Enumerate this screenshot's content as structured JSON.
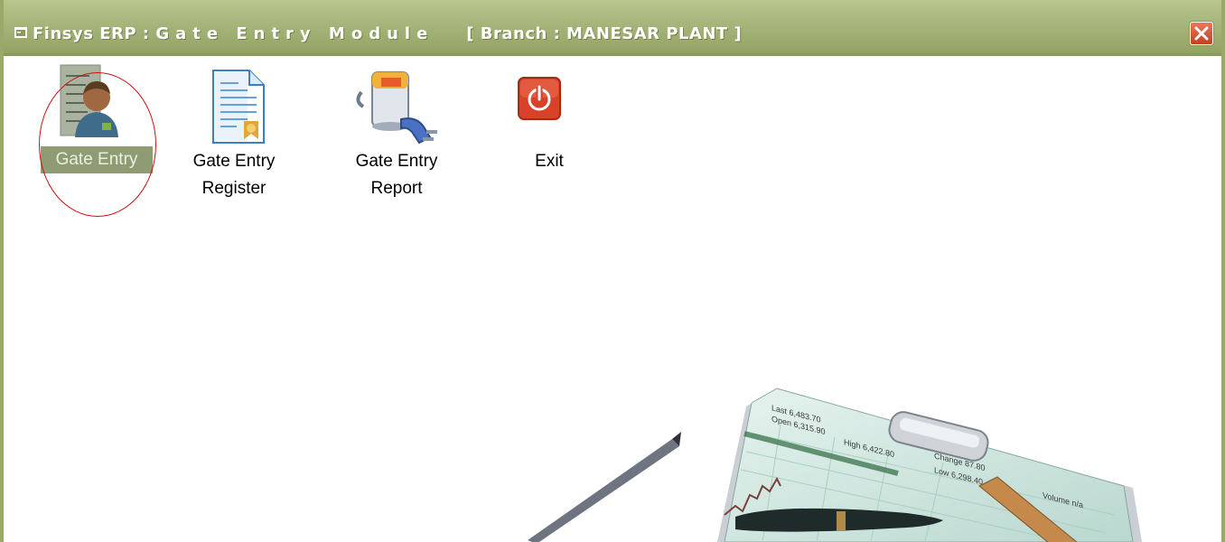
{
  "window": {
    "app_name": "Finsys ERP",
    "separator": ":",
    "module_name": "Gate Entry Module",
    "branch": "[ Branch : MANESAR PLANT ]",
    "close_icon": "close-icon"
  },
  "toolbar": {
    "items": [
      {
        "label": "Gate Entry",
        "icon": "gate-entry-person-icon",
        "selected": true
      },
      {
        "label": "Gate Entry\nRegister",
        "icon": "register-document-icon",
        "selected": false
      },
      {
        "label": "Gate Entry\nReport",
        "icon": "report-plug-icon",
        "selected": false
      },
      {
        "label": "Exit",
        "icon": "power-exit-icon",
        "selected": false
      }
    ]
  },
  "annotation": {
    "highlight_color": "#d01010"
  },
  "colors": {
    "titlebar": "#a6b57a",
    "border": "#9aa969",
    "selection": "#8f9c73",
    "exit_red": "#d9412a"
  }
}
